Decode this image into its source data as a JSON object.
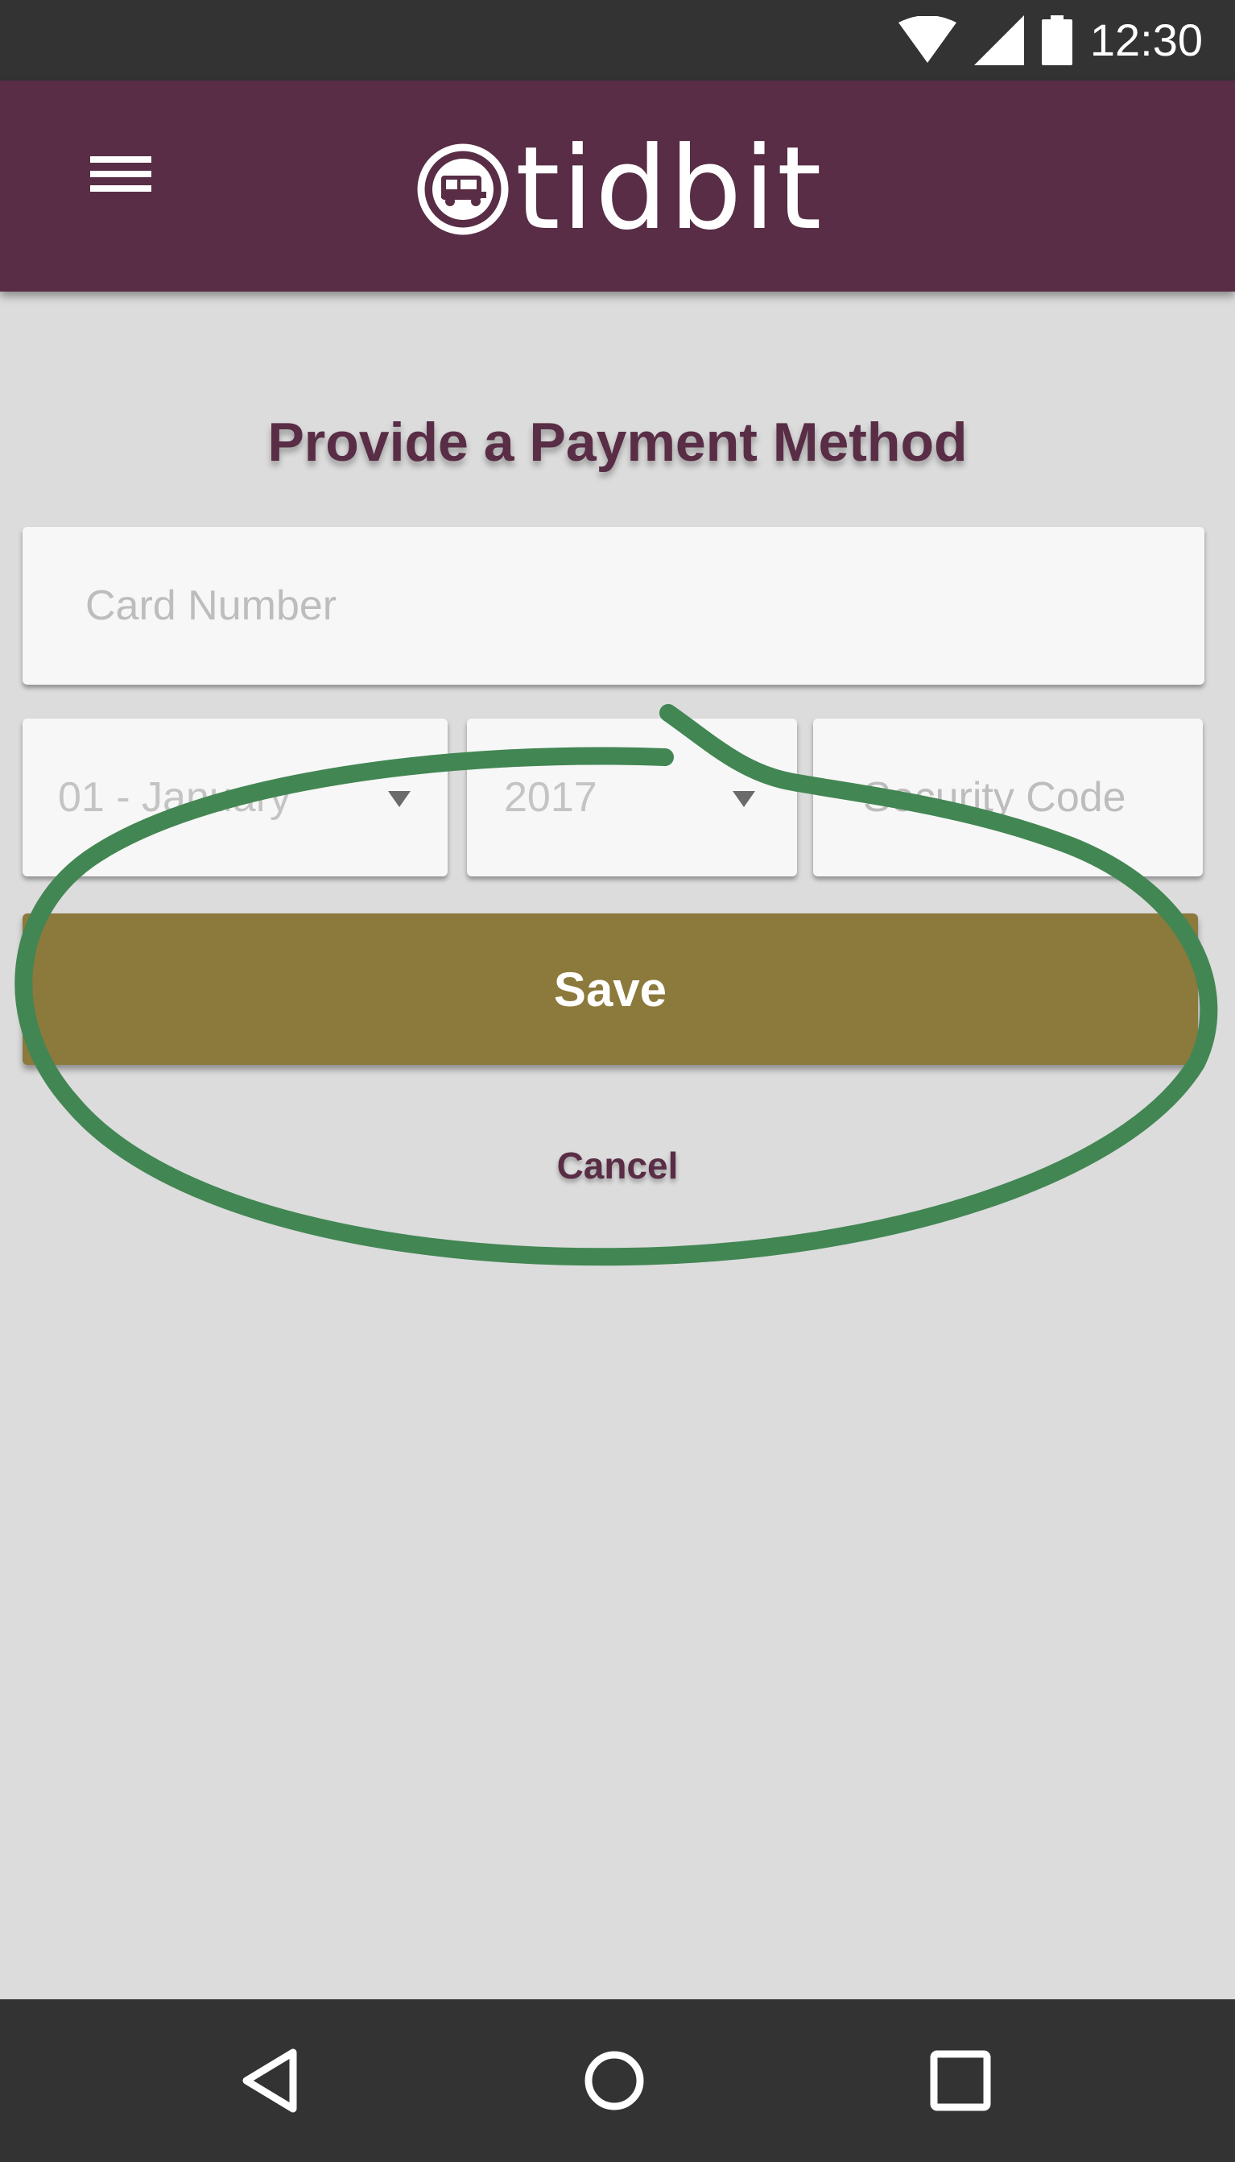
{
  "status_bar": {
    "time": "12:30",
    "icons": [
      "wifi-icon",
      "signal-icon",
      "battery-icon"
    ]
  },
  "app_bar": {
    "menu_icon": "menu-icon",
    "logo_text": "tidbit",
    "logo_icon": "truck-logo-icon"
  },
  "form": {
    "title": "Provide a Payment Method",
    "card_number_placeholder": "Card Number",
    "month_value": "01 - January",
    "year_value": "2017",
    "security_code_placeholder": "Security Code",
    "save_label": "Save",
    "cancel_label": "Cancel"
  },
  "nav_bar": {
    "buttons": [
      "back-icon",
      "home-icon",
      "recents-icon"
    ]
  },
  "colors": {
    "app_bar": "#582d45",
    "save_button": "#8c793c",
    "background": "#dcdcdc",
    "annotation_stroke": "#428653",
    "system_bars": "#333333"
  }
}
